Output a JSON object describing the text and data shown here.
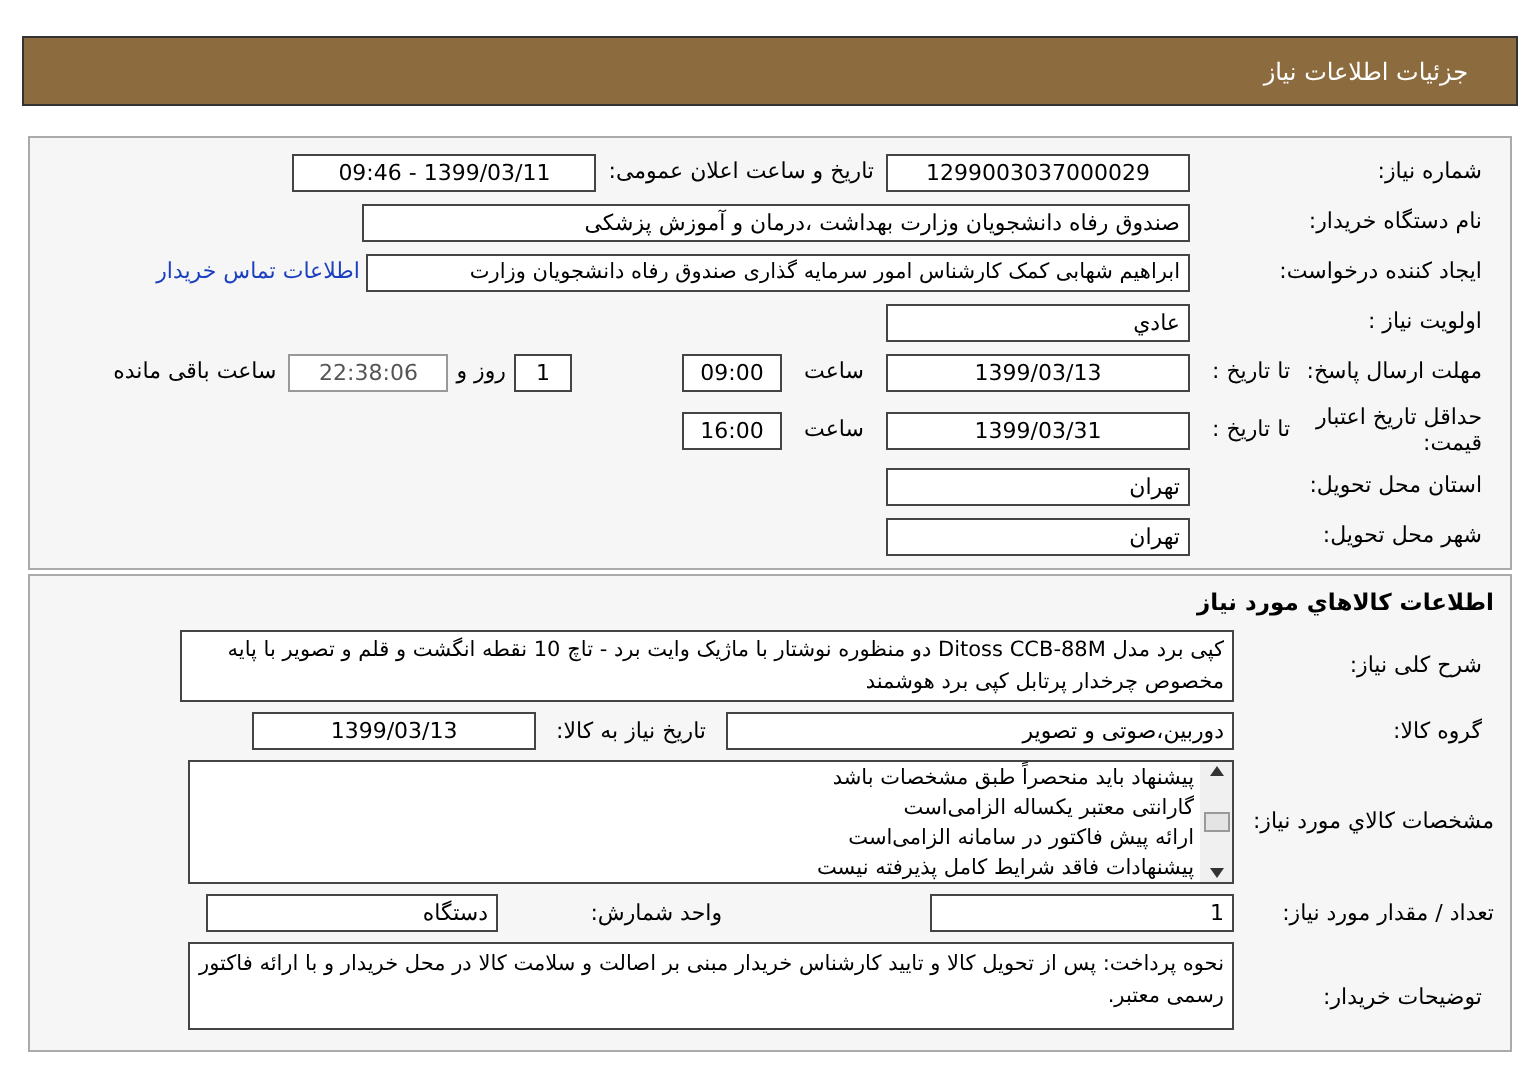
{
  "header": {
    "title": "جزئیات اطلاعات نیاز"
  },
  "need_info": {
    "need_number": {
      "label": "شماره نیاز:",
      "value": "1299003037000029"
    },
    "announce": {
      "label": "تاریخ و ساعت اعلان عمومی:",
      "value": "1399/03/11 - 09:46"
    },
    "buyer_org": {
      "label": "نام دستگاه خریدار:",
      "value": "صندوق رفاه دانشجویان وزارت بهداشت ،درمان و آموزش پزشکی"
    },
    "creator": {
      "label": "ایجاد کننده درخواست:",
      "value": "ابراهیم شهابی کمک کارشناس امور سرمایه گذاری صندوق رفاه دانشجویان وزارت",
      "link": "اطلاعات تماس خریدار"
    },
    "priority": {
      "label": "اولویت نیاز :",
      "value": "عادي"
    },
    "deadline": {
      "label": "مهلت ارسال پاسخ:",
      "to_date_label": "تا تاریخ :",
      "date": "1399/03/13",
      "time_label": "ساعت",
      "time": "09:00",
      "days": "1",
      "days_label": "روز و",
      "remaining": "22:38:06",
      "remaining_label": "ساعت باقی مانده"
    },
    "validity": {
      "label": "حداقل تاریخ اعتبار قیمت:",
      "to_date_label": "تا تاریخ :",
      "date": "1399/03/31",
      "time_label": "ساعت",
      "time": "16:00"
    },
    "province": {
      "label": "استان محل تحویل:",
      "value": "تهران"
    },
    "city": {
      "label": "شهر محل تحویل:",
      "value": "تهران"
    }
  },
  "goods": {
    "title": "اطلاعات کالاهاي مورد نیاز",
    "description": {
      "label": "شرح کلی نیاز:",
      "value": "کپی برد مدل Ditoss CCB-88M دو منظوره نوشتار با ماژیک وایت برد - تاچ 10 نقطه انگشت و قلم و تصویر با پایه مخصوص چرخدار پرتابل کپی برد هوشمند"
    },
    "group": {
      "label": "گروه کالا:",
      "value": "دوربین،صوتی و تصویر"
    },
    "need_date": {
      "label": "تاریخ نیاز به کالا:",
      "value": "1399/03/13"
    },
    "specs": {
      "label": "مشخصات کالاي مورد نیاز:",
      "items": [
        "پیشنهاد باید منحصراً طبق مشخصات باشد",
        "گارانتی معتبر یکساله الزامی‌است",
        "ارائه پیش فاکتور در سامانه الزامی‌است",
        "پیشنهادات فاقد شرایط کامل پذیرفته نیست"
      ]
    },
    "quantity": {
      "label": "تعداد / مقدار مورد نیاز:",
      "value": "1"
    },
    "unit": {
      "label": "واحد شمارش:",
      "value": "دستگاه"
    },
    "notes": {
      "label": "توضیحات خریدار:",
      "value": "نحوه پرداخت: پس از تحویل کالا و تایید کارشناس خریدار مبنی بر اصالت و سلامت کالا در محل خریدار و با ارائه فاکتور رسمی معتبر."
    }
  }
}
